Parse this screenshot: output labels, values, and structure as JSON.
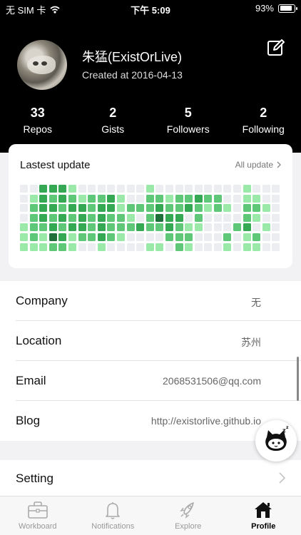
{
  "status_bar": {
    "carrier": "无 SIM 卡",
    "time": "下午 5:09",
    "battery": "93%",
    "battery_level": 0.93
  },
  "profile": {
    "name": "朱猛(ExistOrLive)",
    "created": "Created at 2016-04-13",
    "stats": [
      {
        "value": "33",
        "label": "Repos"
      },
      {
        "value": "2",
        "label": "Gists"
      },
      {
        "value": "5",
        "label": "Followers"
      },
      {
        "value": "2",
        "label": "Following"
      }
    ]
  },
  "contributions": {
    "title": "Lastest update",
    "link": "All update",
    "colors": [
      "#ebedf0",
      "#9be9a8",
      "#5fc878",
      "#34a853",
      "#1f6f3a"
    ],
    "levels": [
      [
        0,
        0,
        3,
        3,
        3,
        1,
        0,
        0,
        0,
        0,
        0,
        0,
        0,
        1,
        0,
        0,
        0,
        0,
        0,
        0,
        0,
        0,
        0,
        1,
        0,
        0,
        0
      ],
      [
        0,
        1,
        3,
        2,
        3,
        2,
        1,
        2,
        2,
        3,
        1,
        0,
        0,
        2,
        2,
        1,
        2,
        2,
        3,
        2,
        2,
        0,
        0,
        1,
        1,
        0,
        0
      ],
      [
        0,
        2,
        3,
        3,
        2,
        3,
        3,
        2,
        3,
        3,
        1,
        2,
        2,
        2,
        3,
        2,
        2,
        3,
        2,
        1,
        2,
        1,
        0,
        2,
        2,
        1,
        0
      ],
      [
        0,
        2,
        3,
        2,
        3,
        2,
        3,
        2,
        3,
        2,
        2,
        1,
        0,
        2,
        4,
        3,
        3,
        0,
        2,
        0,
        0,
        0,
        0,
        2,
        1,
        0,
        0
      ],
      [
        1,
        2,
        2,
        3,
        2,
        3,
        3,
        2,
        3,
        2,
        2,
        2,
        3,
        2,
        2,
        3,
        2,
        1,
        1,
        0,
        0,
        0,
        2,
        3,
        0,
        1,
        0
      ],
      [
        1,
        2,
        1,
        4,
        3,
        1,
        2,
        2,
        3,
        2,
        1,
        0,
        0,
        0,
        0,
        2,
        2,
        2,
        0,
        0,
        0,
        2,
        0,
        1,
        2,
        0,
        0
      ],
      [
        1,
        1,
        1,
        2,
        2,
        1,
        0,
        0,
        1,
        0,
        0,
        0,
        0,
        1,
        1,
        0,
        2,
        1,
        0,
        0,
        0,
        1,
        0,
        1,
        1,
        0,
        0
      ]
    ]
  },
  "info": [
    {
      "label": "Company",
      "value": "无"
    },
    {
      "label": "Location",
      "value": "苏州"
    },
    {
      "label": "Email",
      "value": "2068531506@qq.com"
    },
    {
      "label": "Blog",
      "value": "http://existorlive.github.io"
    }
  ],
  "setting": {
    "label": "Setting"
  },
  "tabs": [
    {
      "label": "Workboard",
      "icon": "briefcase-icon"
    },
    {
      "label": "Notifications",
      "icon": "bell-icon"
    },
    {
      "label": "Explore",
      "icon": "rocket-icon"
    },
    {
      "label": "Profile",
      "icon": "house-icon",
      "active": true
    }
  ]
}
